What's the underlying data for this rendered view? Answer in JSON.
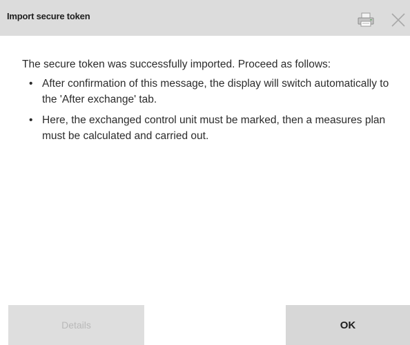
{
  "dialog": {
    "title": "Import secure token",
    "icons": {
      "print": "printer-icon",
      "close": "close-icon"
    }
  },
  "message": {
    "intro": "The secure token was successfully imported. Proceed as follows:",
    "bullets": [
      "After confirmation of this message, the display will switch automatically to the 'After exchange' tab.",
      "Here, the exchanged control unit must be marked, then a measures plan must be calculated and carried out."
    ]
  },
  "buttons": {
    "details_label": "Details",
    "ok_label": "OK"
  },
  "colors": {
    "titlebar_bg": "#dcdcdc",
    "button_bg": "#d7d7d7",
    "disabled_text": "#b8b8b8",
    "text": "#2b2b2b"
  }
}
